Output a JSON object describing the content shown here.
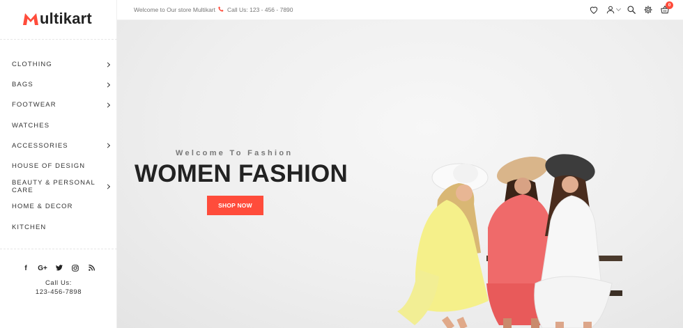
{
  "brand": {
    "logo_text": "ultikart",
    "accent": "#ff4c3b"
  },
  "sidebar": {
    "items": [
      {
        "label": "CLOTHING",
        "has_submenu": true
      },
      {
        "label": "BAGS",
        "has_submenu": true
      },
      {
        "label": "FOOTWEAR",
        "has_submenu": true
      },
      {
        "label": "WATCHES",
        "has_submenu": false
      },
      {
        "label": "ACCESSORIES",
        "has_submenu": true
      },
      {
        "label": "HOUSE OF DESIGN",
        "has_submenu": false
      },
      {
        "label": "BEAUTY & PERSONAL CARE",
        "has_submenu": true
      },
      {
        "label": "HOME & DECOR",
        "has_submenu": false
      },
      {
        "label": "KITCHEN",
        "has_submenu": false
      }
    ],
    "social_icons": [
      "facebook-icon",
      "google-plus-icon",
      "twitter-icon",
      "instagram-icon",
      "rss-icon"
    ],
    "call_label": "Call Us:",
    "call_number": "123-456-7898"
  },
  "topbar": {
    "welcome": "Welcome to Our store Multikart",
    "phone": "Call Us: 123 - 456 - 7890",
    "cart_count": "0",
    "icons": [
      "heart-icon",
      "user-icon",
      "search-icon",
      "settings-icon",
      "cart-icon"
    ]
  },
  "hero": {
    "subtitle": "Welcome To Fashion",
    "title": "WOMEN FASHION",
    "button_label": "SHOP NOW"
  }
}
